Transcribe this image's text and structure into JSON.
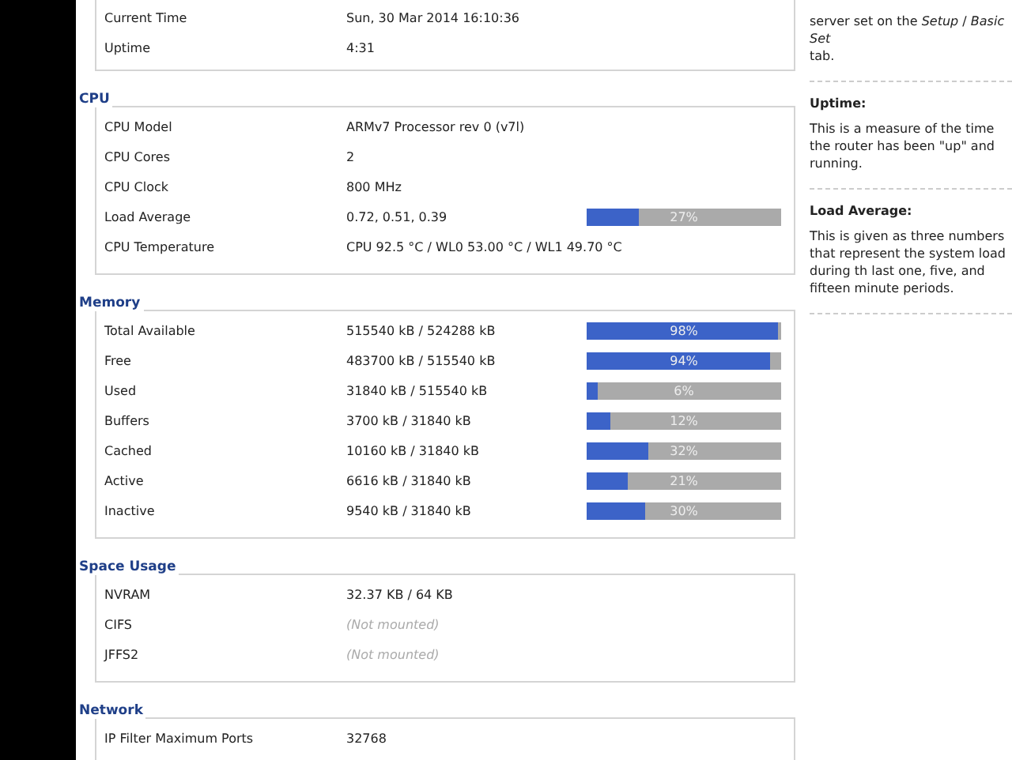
{
  "sections": [
    {
      "rows": [
        {
          "label": "Current Time",
          "value": "Sun, 30 Mar 2014 16:10:36",
          "kind": "text"
        },
        {
          "label": "Uptime",
          "value": "4:31",
          "kind": "text"
        }
      ]
    },
    {
      "legend": "CPU",
      "rows": [
        {
          "label": "CPU Model",
          "value": "ARMv7 Processor rev 0 (v7l)",
          "kind": "text"
        },
        {
          "label": "CPU Cores",
          "value": "2",
          "kind": "text"
        },
        {
          "label": "CPU Clock",
          "value": "800 MHz",
          "kind": "text"
        },
        {
          "label": "Load Average",
          "value": "0.72, 0.51, 0.39",
          "kind": "bar",
          "level": 0.27,
          "reading": "27%"
        },
        {
          "label": "CPU Temperature",
          "value": "CPU 92.5 °C / WL0 53.00 °C / WL1 49.70 °C",
          "kind": "text"
        }
      ]
    },
    {
      "legend": "Memory",
      "rows": [
        {
          "label": "Total Available",
          "value": "515540 kB / 524288 kB",
          "kind": "bar",
          "level": 0.98,
          "reading": "98%"
        },
        {
          "label": "Free",
          "value": "483700 kB / 515540 kB",
          "kind": "bar",
          "level": 0.94,
          "reading": "94%"
        },
        {
          "label": "Used",
          "value": "31840 kB / 515540 kB",
          "kind": "bar",
          "level": 0.06,
          "reading": "6%"
        },
        {
          "label": "Buffers",
          "value": "3700 kB / 31840 kB",
          "kind": "bar",
          "level": 0.12,
          "reading": "12%"
        },
        {
          "label": "Cached",
          "value": "10160 kB / 31840 kB",
          "kind": "bar",
          "level": 0.32,
          "reading": "32%"
        },
        {
          "label": "Active",
          "value": "6616 kB / 31840 kB",
          "kind": "bar",
          "level": 0.21,
          "reading": "21%"
        },
        {
          "label": "Inactive",
          "value": "9540 kB / 31840 kB",
          "kind": "bar",
          "level": 0.3,
          "reading": "30%"
        }
      ]
    },
    {
      "legend": "Space Usage",
      "rows": [
        {
          "label": "NVRAM",
          "value": "32.37 KB / 64 KB",
          "kind": "text"
        },
        {
          "label": "CIFS",
          "value": "(Not mounted)",
          "kind": "muted"
        },
        {
          "label": "JFFS2",
          "value": "(Not mounted)",
          "kind": "muted"
        }
      ]
    },
    {
      "legend": "Network",
      "rows": [
        {
          "label": "IP Filter Maximum Ports",
          "value": "32768",
          "kind": "text"
        }
      ]
    }
  ],
  "help": [
    {
      "text": "server set on the *Setup* / *Basic Set*\ntab."
    },
    {
      "title": "Uptime:",
      "text": "This is a measure of the time the router has been \"up\" and running."
    },
    {
      "title": "Load Average:",
      "text": "This is given as three numbers that represent the system load during th last one, five, and fifteen minute periods."
    }
  ]
}
